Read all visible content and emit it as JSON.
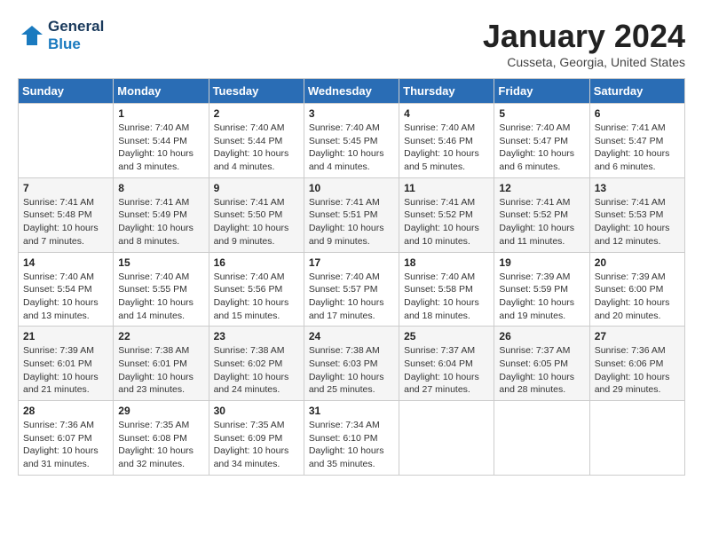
{
  "header": {
    "logo_line1": "General",
    "logo_line2": "Blue",
    "month": "January 2024",
    "location": "Cusseta, Georgia, United States"
  },
  "days_of_week": [
    "Sunday",
    "Monday",
    "Tuesday",
    "Wednesday",
    "Thursday",
    "Friday",
    "Saturday"
  ],
  "weeks": [
    [
      {
        "num": "",
        "info": ""
      },
      {
        "num": "1",
        "info": "Sunrise: 7:40 AM\nSunset: 5:44 PM\nDaylight: 10 hours\nand 3 minutes."
      },
      {
        "num": "2",
        "info": "Sunrise: 7:40 AM\nSunset: 5:44 PM\nDaylight: 10 hours\nand 4 minutes."
      },
      {
        "num": "3",
        "info": "Sunrise: 7:40 AM\nSunset: 5:45 PM\nDaylight: 10 hours\nand 4 minutes."
      },
      {
        "num": "4",
        "info": "Sunrise: 7:40 AM\nSunset: 5:46 PM\nDaylight: 10 hours\nand 5 minutes."
      },
      {
        "num": "5",
        "info": "Sunrise: 7:40 AM\nSunset: 5:47 PM\nDaylight: 10 hours\nand 6 minutes."
      },
      {
        "num": "6",
        "info": "Sunrise: 7:41 AM\nSunset: 5:47 PM\nDaylight: 10 hours\nand 6 minutes."
      }
    ],
    [
      {
        "num": "7",
        "info": "Sunrise: 7:41 AM\nSunset: 5:48 PM\nDaylight: 10 hours\nand 7 minutes."
      },
      {
        "num": "8",
        "info": "Sunrise: 7:41 AM\nSunset: 5:49 PM\nDaylight: 10 hours\nand 8 minutes."
      },
      {
        "num": "9",
        "info": "Sunrise: 7:41 AM\nSunset: 5:50 PM\nDaylight: 10 hours\nand 9 minutes."
      },
      {
        "num": "10",
        "info": "Sunrise: 7:41 AM\nSunset: 5:51 PM\nDaylight: 10 hours\nand 9 minutes."
      },
      {
        "num": "11",
        "info": "Sunrise: 7:41 AM\nSunset: 5:52 PM\nDaylight: 10 hours\nand 10 minutes."
      },
      {
        "num": "12",
        "info": "Sunrise: 7:41 AM\nSunset: 5:52 PM\nDaylight: 10 hours\nand 11 minutes."
      },
      {
        "num": "13",
        "info": "Sunrise: 7:41 AM\nSunset: 5:53 PM\nDaylight: 10 hours\nand 12 minutes."
      }
    ],
    [
      {
        "num": "14",
        "info": "Sunrise: 7:40 AM\nSunset: 5:54 PM\nDaylight: 10 hours\nand 13 minutes."
      },
      {
        "num": "15",
        "info": "Sunrise: 7:40 AM\nSunset: 5:55 PM\nDaylight: 10 hours\nand 14 minutes."
      },
      {
        "num": "16",
        "info": "Sunrise: 7:40 AM\nSunset: 5:56 PM\nDaylight: 10 hours\nand 15 minutes."
      },
      {
        "num": "17",
        "info": "Sunrise: 7:40 AM\nSunset: 5:57 PM\nDaylight: 10 hours\nand 17 minutes."
      },
      {
        "num": "18",
        "info": "Sunrise: 7:40 AM\nSunset: 5:58 PM\nDaylight: 10 hours\nand 18 minutes."
      },
      {
        "num": "19",
        "info": "Sunrise: 7:39 AM\nSunset: 5:59 PM\nDaylight: 10 hours\nand 19 minutes."
      },
      {
        "num": "20",
        "info": "Sunrise: 7:39 AM\nSunset: 6:00 PM\nDaylight: 10 hours\nand 20 minutes."
      }
    ],
    [
      {
        "num": "21",
        "info": "Sunrise: 7:39 AM\nSunset: 6:01 PM\nDaylight: 10 hours\nand 21 minutes."
      },
      {
        "num": "22",
        "info": "Sunrise: 7:38 AM\nSunset: 6:01 PM\nDaylight: 10 hours\nand 23 minutes."
      },
      {
        "num": "23",
        "info": "Sunrise: 7:38 AM\nSunset: 6:02 PM\nDaylight: 10 hours\nand 24 minutes."
      },
      {
        "num": "24",
        "info": "Sunrise: 7:38 AM\nSunset: 6:03 PM\nDaylight: 10 hours\nand 25 minutes."
      },
      {
        "num": "25",
        "info": "Sunrise: 7:37 AM\nSunset: 6:04 PM\nDaylight: 10 hours\nand 27 minutes."
      },
      {
        "num": "26",
        "info": "Sunrise: 7:37 AM\nSunset: 6:05 PM\nDaylight: 10 hours\nand 28 minutes."
      },
      {
        "num": "27",
        "info": "Sunrise: 7:36 AM\nSunset: 6:06 PM\nDaylight: 10 hours\nand 29 minutes."
      }
    ],
    [
      {
        "num": "28",
        "info": "Sunrise: 7:36 AM\nSunset: 6:07 PM\nDaylight: 10 hours\nand 31 minutes."
      },
      {
        "num": "29",
        "info": "Sunrise: 7:35 AM\nSunset: 6:08 PM\nDaylight: 10 hours\nand 32 minutes."
      },
      {
        "num": "30",
        "info": "Sunrise: 7:35 AM\nSunset: 6:09 PM\nDaylight: 10 hours\nand 34 minutes."
      },
      {
        "num": "31",
        "info": "Sunrise: 7:34 AM\nSunset: 6:10 PM\nDaylight: 10 hours\nand 35 minutes."
      },
      {
        "num": "",
        "info": ""
      },
      {
        "num": "",
        "info": ""
      },
      {
        "num": "",
        "info": ""
      }
    ]
  ]
}
